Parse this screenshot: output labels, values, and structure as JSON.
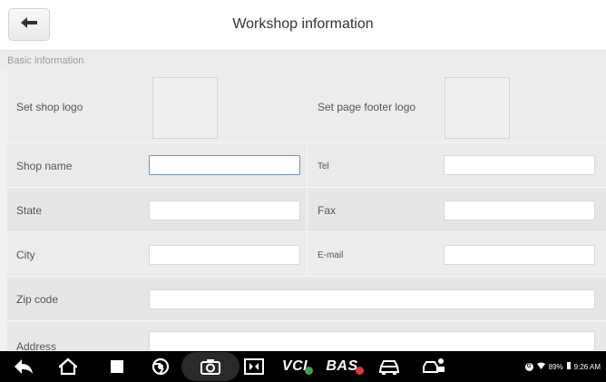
{
  "header": {
    "title": "Workshop information"
  },
  "section": {
    "caption": "Basic information"
  },
  "logos": {
    "shop_logo_label": "Set shop logo",
    "footer_logo_label": "Set page footer logo"
  },
  "fields": {
    "shop_name": {
      "label": "Shop name",
      "value": ""
    },
    "tel": {
      "label": "Tel",
      "value": ""
    },
    "state": {
      "label": "State",
      "value": ""
    },
    "fax": {
      "label": "Fax",
      "value": ""
    },
    "city": {
      "label": "City",
      "value": ""
    },
    "email": {
      "label": "E-mail",
      "value": ""
    },
    "zip": {
      "label": "Zip code",
      "value": ""
    },
    "address": {
      "label": "Address",
      "value": ""
    }
  },
  "navbar": {
    "vci_label": "VCI",
    "bas_label": "BAS",
    "icons": [
      "back-arrow-icon",
      "home-icon",
      "recent-apps-icon",
      "browser-icon",
      "camera-icon",
      "display-icon",
      "vci-icon",
      "bas-icon",
      "car-icon",
      "car-service-icon"
    ]
  },
  "status_bar": {
    "battery": "89%",
    "time": "9:26 AM"
  },
  "colors": {
    "header_bg": "#ffffff",
    "panel_bg": "#e9e9e9",
    "navbar_bg": "#000000",
    "focus_border": "#6d8fbd"
  }
}
